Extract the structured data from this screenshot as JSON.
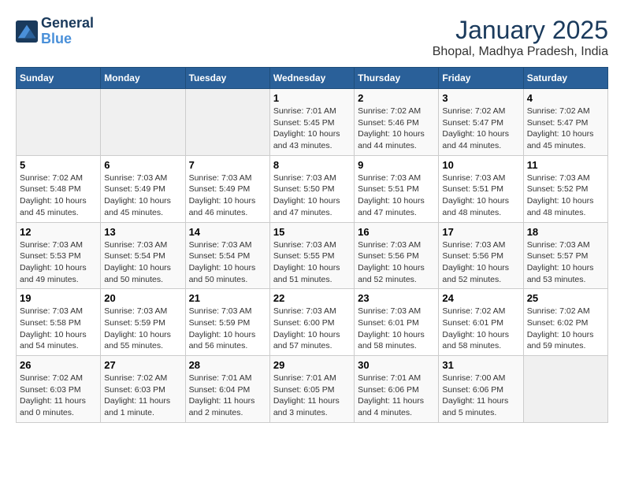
{
  "header": {
    "logo_line1": "General",
    "logo_line2": "Blue",
    "month_title": "January 2025",
    "subtitle": "Bhopal, Madhya Pradesh, India"
  },
  "days_of_week": [
    "Sunday",
    "Monday",
    "Tuesday",
    "Wednesday",
    "Thursday",
    "Friday",
    "Saturday"
  ],
  "weeks": [
    [
      {
        "num": "",
        "info": ""
      },
      {
        "num": "",
        "info": ""
      },
      {
        "num": "",
        "info": ""
      },
      {
        "num": "1",
        "info": "Sunrise: 7:01 AM\nSunset: 5:45 PM\nDaylight: 10 hours\nand 43 minutes."
      },
      {
        "num": "2",
        "info": "Sunrise: 7:02 AM\nSunset: 5:46 PM\nDaylight: 10 hours\nand 44 minutes."
      },
      {
        "num": "3",
        "info": "Sunrise: 7:02 AM\nSunset: 5:47 PM\nDaylight: 10 hours\nand 44 minutes."
      },
      {
        "num": "4",
        "info": "Sunrise: 7:02 AM\nSunset: 5:47 PM\nDaylight: 10 hours\nand 45 minutes."
      }
    ],
    [
      {
        "num": "5",
        "info": "Sunrise: 7:02 AM\nSunset: 5:48 PM\nDaylight: 10 hours\nand 45 minutes."
      },
      {
        "num": "6",
        "info": "Sunrise: 7:03 AM\nSunset: 5:49 PM\nDaylight: 10 hours\nand 45 minutes."
      },
      {
        "num": "7",
        "info": "Sunrise: 7:03 AM\nSunset: 5:49 PM\nDaylight: 10 hours\nand 46 minutes."
      },
      {
        "num": "8",
        "info": "Sunrise: 7:03 AM\nSunset: 5:50 PM\nDaylight: 10 hours\nand 47 minutes."
      },
      {
        "num": "9",
        "info": "Sunrise: 7:03 AM\nSunset: 5:51 PM\nDaylight: 10 hours\nand 47 minutes."
      },
      {
        "num": "10",
        "info": "Sunrise: 7:03 AM\nSunset: 5:51 PM\nDaylight: 10 hours\nand 48 minutes."
      },
      {
        "num": "11",
        "info": "Sunrise: 7:03 AM\nSunset: 5:52 PM\nDaylight: 10 hours\nand 48 minutes."
      }
    ],
    [
      {
        "num": "12",
        "info": "Sunrise: 7:03 AM\nSunset: 5:53 PM\nDaylight: 10 hours\nand 49 minutes."
      },
      {
        "num": "13",
        "info": "Sunrise: 7:03 AM\nSunset: 5:54 PM\nDaylight: 10 hours\nand 50 minutes."
      },
      {
        "num": "14",
        "info": "Sunrise: 7:03 AM\nSunset: 5:54 PM\nDaylight: 10 hours\nand 50 minutes."
      },
      {
        "num": "15",
        "info": "Sunrise: 7:03 AM\nSunset: 5:55 PM\nDaylight: 10 hours\nand 51 minutes."
      },
      {
        "num": "16",
        "info": "Sunrise: 7:03 AM\nSunset: 5:56 PM\nDaylight: 10 hours\nand 52 minutes."
      },
      {
        "num": "17",
        "info": "Sunrise: 7:03 AM\nSunset: 5:56 PM\nDaylight: 10 hours\nand 52 minutes."
      },
      {
        "num": "18",
        "info": "Sunrise: 7:03 AM\nSunset: 5:57 PM\nDaylight: 10 hours\nand 53 minutes."
      }
    ],
    [
      {
        "num": "19",
        "info": "Sunrise: 7:03 AM\nSunset: 5:58 PM\nDaylight: 10 hours\nand 54 minutes."
      },
      {
        "num": "20",
        "info": "Sunrise: 7:03 AM\nSunset: 5:59 PM\nDaylight: 10 hours\nand 55 minutes."
      },
      {
        "num": "21",
        "info": "Sunrise: 7:03 AM\nSunset: 5:59 PM\nDaylight: 10 hours\nand 56 minutes."
      },
      {
        "num": "22",
        "info": "Sunrise: 7:03 AM\nSunset: 6:00 PM\nDaylight: 10 hours\nand 57 minutes."
      },
      {
        "num": "23",
        "info": "Sunrise: 7:03 AM\nSunset: 6:01 PM\nDaylight: 10 hours\nand 58 minutes."
      },
      {
        "num": "24",
        "info": "Sunrise: 7:02 AM\nSunset: 6:01 PM\nDaylight: 10 hours\nand 58 minutes."
      },
      {
        "num": "25",
        "info": "Sunrise: 7:02 AM\nSunset: 6:02 PM\nDaylight: 10 hours\nand 59 minutes."
      }
    ],
    [
      {
        "num": "26",
        "info": "Sunrise: 7:02 AM\nSunset: 6:03 PM\nDaylight: 11 hours\nand 0 minutes."
      },
      {
        "num": "27",
        "info": "Sunrise: 7:02 AM\nSunset: 6:03 PM\nDaylight: 11 hours\nand 1 minute."
      },
      {
        "num": "28",
        "info": "Sunrise: 7:01 AM\nSunset: 6:04 PM\nDaylight: 11 hours\nand 2 minutes."
      },
      {
        "num": "29",
        "info": "Sunrise: 7:01 AM\nSunset: 6:05 PM\nDaylight: 11 hours\nand 3 minutes."
      },
      {
        "num": "30",
        "info": "Sunrise: 7:01 AM\nSunset: 6:06 PM\nDaylight: 11 hours\nand 4 minutes."
      },
      {
        "num": "31",
        "info": "Sunrise: 7:00 AM\nSunset: 6:06 PM\nDaylight: 11 hours\nand 5 minutes."
      },
      {
        "num": "",
        "info": ""
      }
    ]
  ]
}
